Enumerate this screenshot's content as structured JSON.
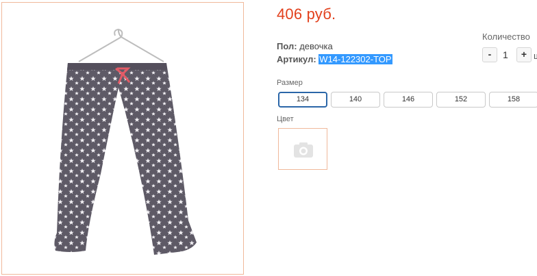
{
  "product": {
    "price": "406 руб.",
    "gender_label": "Пол:",
    "gender_value": "девочка",
    "sku_label": "Артикул:",
    "sku_value": "W14-122302-TOP",
    "image_icon": "pajama-pants-photo"
  },
  "quantity": {
    "label": "Количество",
    "minus": "-",
    "value": "1",
    "plus": "+",
    "unit": "ш"
  },
  "size": {
    "label": "Размер",
    "options": [
      "134",
      "140",
      "146",
      "152",
      "158"
    ],
    "selected": "134"
  },
  "color": {
    "label": "Цвет",
    "swatch_icon": "camera-icon"
  },
  "colors": {
    "price": "#e2401c",
    "frame_border": "#f0b89a",
    "selected_border": "#2a66a8",
    "selection_highlight": "#3399ff"
  }
}
